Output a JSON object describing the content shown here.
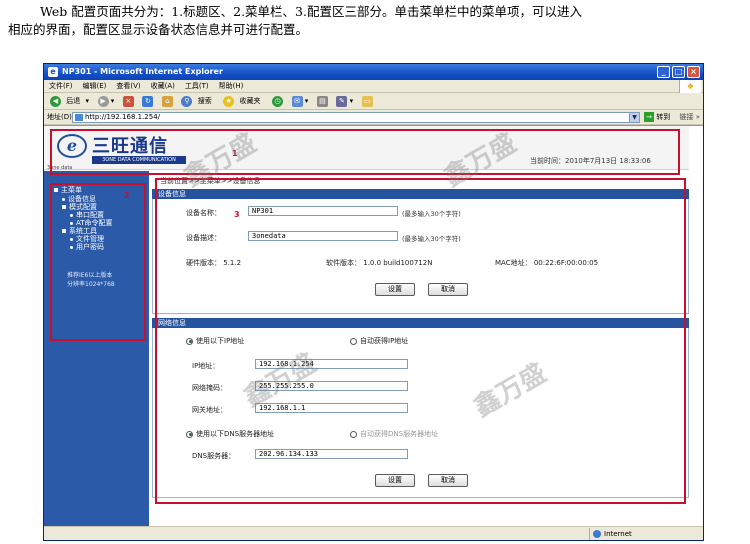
{
  "intro": {
    "line1": "Web 配置页面共分为：1.标题区、2.菜单栏、3.配置区三部分。单击菜单栏中的菜单项，可以进入",
    "line2": "相应的界面，配置区显示设备状态信息并可进行配置。"
  },
  "browser": {
    "title": "NP301 - Microsoft Internet Explorer",
    "menu": [
      "文件(F)",
      "编辑(E)",
      "查看(V)",
      "收藏(A)",
      "工具(T)",
      "帮助(H)"
    ],
    "toolbar": {
      "back": "后退",
      "search": "搜索",
      "favorites": "收藏夹"
    },
    "address_label": "地址(D)",
    "address_value": "http://192.168.1.254/",
    "go_label": "转到",
    "links_label": "链接",
    "status_zone": "Internet"
  },
  "header": {
    "logo_cn": "三旺通信",
    "logo_en": "3ONE DATA COMMUNICATION",
    "logo_sub": "3one data",
    "time_label": "当前时间：",
    "time_value": "2010年7月13日 18:33:06",
    "area_number": "1"
  },
  "sidebar": {
    "area_number": "2",
    "main_menu": "主菜单",
    "items": [
      "设备信息",
      "模式配置",
      "串口配置",
      "AT命令配置",
      "系统工具",
      "文件管理",
      "用户密码"
    ],
    "note_line1": "推荐IE6以上版本",
    "note_line2": "分辨率1024*768"
  },
  "main": {
    "area_number": "3",
    "breadcrumb": "当前位置>>主菜单>>设备信息",
    "device_section": {
      "title": "设备信息",
      "name_label": "设备名称：",
      "name_value": "NP301",
      "name_hint": "(最多输入30个字符)",
      "desc_label": "设备描述：",
      "desc_value": "3onedata",
      "desc_hint": "(最多输入30个字符)",
      "hw_label": "硬件版本：",
      "hw_value": "5.1.2",
      "sw_label": "软件版本：",
      "sw_value": "1.0.0 build100712N",
      "mac_label": "MAC地址：",
      "mac_value": "00:22:6F:00:00:05",
      "apply": "设置",
      "cancel": "取消"
    },
    "network_section": {
      "title": "网络信息",
      "static_ip": "使用以下IP地址",
      "auto_ip": "自动获得IP地址",
      "ip_label": "IP地址：",
      "ip_value": "192.168.1.254",
      "mask_label": "网络掩码：",
      "mask_value": "255.255.255.0",
      "gw_label": "网关地址：",
      "gw_value": "192.168.1.1",
      "static_dns": "使用以下DNS服务器地址",
      "auto_dns": "自动获得DNS服务器地址",
      "dns_label": "DNS服务器：",
      "dns_value": "202.96.134.133",
      "apply": "设置",
      "cancel": "取消"
    }
  },
  "watermark": "鑫万盛"
}
